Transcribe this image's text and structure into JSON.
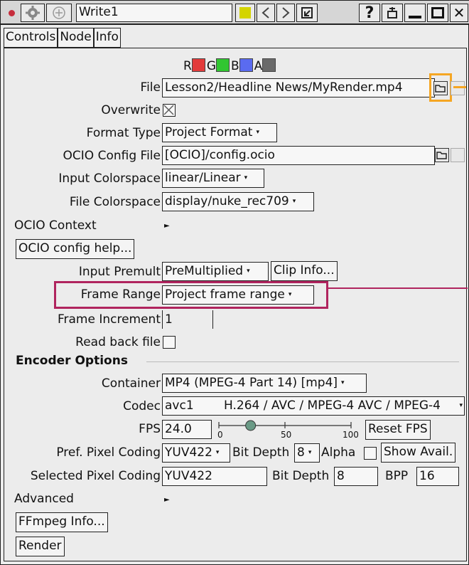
{
  "titlebar": {
    "node_name": "Write1",
    "color_swatch": "#d4d400"
  },
  "tabs": [
    "Controls",
    "Node",
    "Info"
  ],
  "channels": {
    "r": "R",
    "g": "G",
    "b": "B",
    "a": "A",
    "colors": {
      "r": "#e23b3b",
      "g": "#31c631",
      "b": "#5a6bf0",
      "a": "#6a6a6a"
    }
  },
  "fields": {
    "file_label": "File",
    "file_value": "Lesson2/Headline News/MyRender.mp4",
    "overwrite_label": "Overwrite",
    "format_type_label": "Format Type",
    "format_type_value": "Project Format",
    "ocio_config_label": "OCIO Config File",
    "ocio_config_value": "[OCIO]/config.ocio",
    "input_cs_label": "Input Colorspace",
    "input_cs_value": "linear/Linear",
    "file_cs_label": "File Colorspace",
    "file_cs_value": "display/nuke_rec709",
    "ocio_context_label": "OCIO Context",
    "ocio_help_button": "OCIO config help...",
    "input_premult_label": "Input Premult",
    "input_premult_value": "PreMultiplied",
    "clip_info_button": "Clip Info...",
    "frame_range_label": "Frame Range",
    "frame_range_value": "Project frame range",
    "frame_increment_label": "Frame Increment",
    "frame_increment_value": "1",
    "read_back_label": "Read back file"
  },
  "encoder": {
    "section_label": "Encoder Options",
    "container_label": "Container",
    "container_value": "MP4 (MPEG-4 Part 14) [mp4]",
    "codec_label": "Codec",
    "codec_value": "avc1",
    "codec_desc": "H.264 / AVC / MPEG-4 AVC / MPEG-4",
    "fps_label": "FPS",
    "fps_value": "24.0",
    "fps_slider": {
      "min": "0",
      "mid": "50",
      "max": "100",
      "value": 24
    },
    "reset_fps_button": "Reset FPS",
    "pref_pixel_label": "Pref. Pixel Coding",
    "pref_pixel_value": "YUV422",
    "bit_depth_label": "Bit Depth",
    "bit_depth_value": "8",
    "alpha_label": "Alpha",
    "show_avail_button": "Show Avail.",
    "selected_pixel_label": "Selected Pixel Coding",
    "selected_pixel_value": "YUV422",
    "sel_bit_depth_label": "Bit Depth",
    "sel_bit_depth_value": "8",
    "bpp_label": "BPP",
    "bpp_value": "16",
    "advanced_label": "Advanced",
    "ffmpeg_info_button": "FFmpeg Info...",
    "render_button": "Render"
  },
  "highlights": {
    "folder_box": "#f5a623",
    "frame_range_box": "#b0245e"
  }
}
